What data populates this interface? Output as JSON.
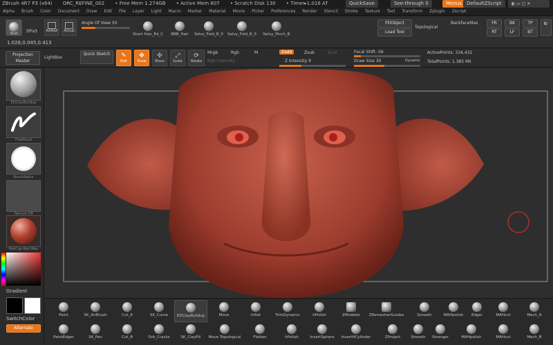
{
  "titlebar": {
    "items": [
      "ZBrush 4R7 P3 (x64)",
      "ORC_REFINE_002",
      "• Free Mem 1.274GB",
      "• Active Mem 607",
      "• Scratch Disk 130",
      "• Timer▸1.016 AT"
    ],
    "quicksave": "QuickSave",
    "see_through": "See-through",
    "see_through_value": "0",
    "menus": "Menus",
    "default_script": "DefaultZScript"
  },
  "menubar": {
    "items": [
      "Alpha",
      "Brush",
      "Color",
      "Document",
      "Draw",
      "Edit",
      "File",
      "Layer",
      "Light",
      "Macro",
      "Marker",
      "Material",
      "Movie",
      "Picker",
      "Preferences",
      "Render",
      "Stencil",
      "Stroke",
      "Texture",
      "Tool",
      "Transform",
      "Zplugin",
      "Zscript"
    ]
  },
  "toolbar": {
    "brush_label": "Brsh",
    "spix_label": "SPix",
    "spix_value": "3",
    "aahalf": "AAHalf",
    "actual": "Actual",
    "angle_of_view_label": "Angle Of View",
    "angle_of_view_value": "50",
    "coords": "1.028,0.045,0.413",
    "brush_slots": [
      "Short Hair_Ed_C",
      "BBB_Hair",
      "Selvy_Fold_B_0",
      "Selvy_Fold_B_0",
      "Selvy_Pinch_B"
    ],
    "fill_object": "FillObject",
    "load_tool": "Load Tool",
    "topological": "Topological",
    "backface_mask": "BackfaceMas",
    "views": [
      "FR",
      "BK",
      "TP",
      "RT",
      "LF",
      "BT"
    ],
    "cut": "8/ "
  },
  "toolbar2": {
    "projection_master": "Projection Master",
    "lightbox": "LightBox",
    "quick_sketch": "Quick Sketch",
    "edit": "Edit",
    "draw": "Draw",
    "move": "Move",
    "scale": "Scale",
    "rotate": "Rotate",
    "mrgb": "Mrgb",
    "rgb": "Rgb",
    "m": "M",
    "zadd": "Zadd",
    "zsub": "Zsub",
    "zcut": "Zcut",
    "rgb_intensity": "Rgb Intensity",
    "z_intensity_label": "Z Intensity",
    "z_intensity_value": "9",
    "focal_shift_label": "Focal Shift",
    "focal_shift_value": "-56",
    "draw_size_label": "Draw Size",
    "draw_size_value": "30",
    "dynamic": "Dynamic",
    "active_points_label": "ActivePoints:",
    "active_points_value": "334,432",
    "total_points_label": "TotalPoints:",
    "total_points_value": "1.385 Mil"
  },
  "leftpanel": {
    "thumbs": [
      "EDClayBuildup",
      "FreeHand",
      "BrushAlpha",
      "Texture Off",
      "MatCap Red Wax"
    ],
    "gradient": "Gradient",
    "switch_color": "SwitchColor",
    "alternate": "Alternate"
  },
  "bottom": {
    "row1": [
      "Paint",
      "SK_AirBrush",
      "Cut_A",
      "SK_Curve",
      "EDClayBuildup",
      "Move",
      "Inflat",
      "TrimDynamic",
      "hPolish",
      "ZModeler",
      "ZRemesherGuides",
      "Smooth",
      "MAHpolish",
      "Edger",
      "MAHcut",
      "Mech_A"
    ],
    "row2": [
      "PaintEdger",
      "SK_Pen",
      "Cut_B",
      "Orb_Cracks",
      "SK_ClayFill",
      "Move Topological",
      "Flatten",
      "hPolish",
      "InsertSphere",
      "InsertHCylinder",
      "ZProject",
      "Smooth",
      "Stronger",
      "MAHpolish",
      "MAHcut",
      "Mech_B"
    ]
  },
  "colors": {
    "accent": "#e8751a",
    "skin": "#b84e3e",
    "viewport_bg": "#2e2e2e"
  }
}
